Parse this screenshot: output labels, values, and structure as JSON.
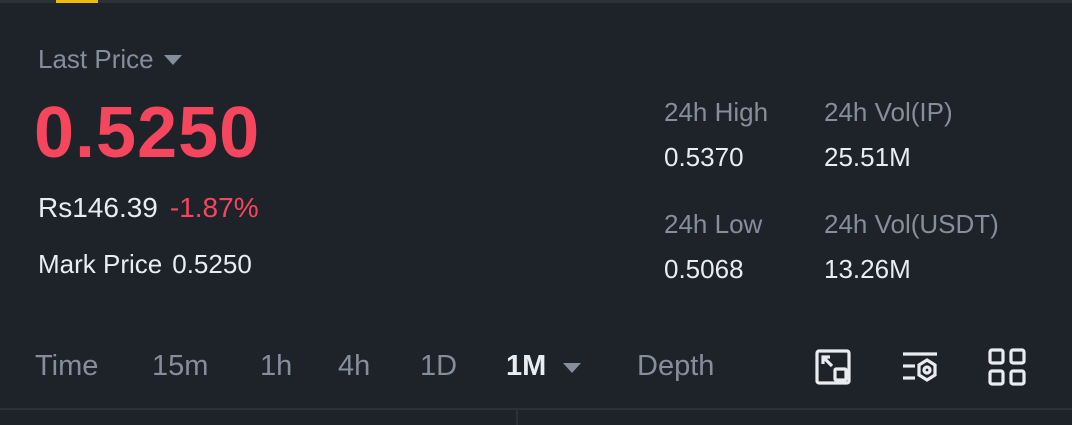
{
  "price_panel": {
    "last_price_label": "Last Price",
    "last_price": "0.5250",
    "fiat_price": "Rs146.39",
    "change_percent": "-1.87%",
    "mark_price_label": "Mark Price",
    "mark_price": "0.5250"
  },
  "stats": {
    "high_label": "24h High",
    "high_value": "0.5370",
    "vol_base_label": "24h Vol(IP)",
    "vol_base_value": "25.51M",
    "low_label": "24h Low",
    "low_value": "0.5068",
    "vol_quote_label": "24h Vol(USDT)",
    "vol_quote_value": "13.26M"
  },
  "chart_tabs": {
    "items": [
      "Time",
      "15m",
      "1h",
      "4h",
      "1D",
      "1M",
      "Depth"
    ],
    "active": "1M"
  },
  "toolbar": {
    "icons": [
      "chart-expand-icon",
      "indicator-settings-icon",
      "grid-layout-icon"
    ]
  },
  "colors": {
    "background": "#1e2329",
    "down": "#f6465d",
    "muted_text": "#848e9c",
    "primary_text": "#eaecef",
    "accent": "#f0b90b"
  }
}
